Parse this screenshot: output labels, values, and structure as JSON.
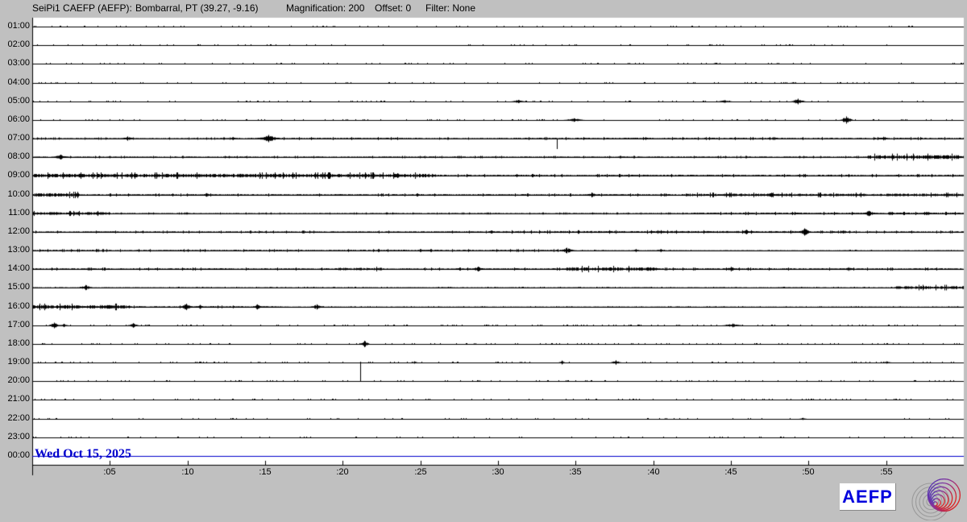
{
  "header": {
    "station": "SeiPi1 CAEFP (AEFP):",
    "location": "Bombarral, PT (39.27, -9.16)",
    "magnification": "Magnification: 200",
    "offset": "Offset: 0",
    "filter": "Filter: None"
  },
  "footer": {
    "date": "Wed Oct 15, 2025",
    "logo_text": "AEFP"
  },
  "colors": {
    "background": "#c0c0c0",
    "plot_bg": "#ffffff",
    "trace": "#000000",
    "accent_blue": "#0000cc"
  },
  "chart_data": {
    "type": "helicorder",
    "title": "24-hour seismogram, one row per hour, 60 minutes per row",
    "x_axis": {
      "minutes_per_row": 60,
      "tick_interval_min": 5,
      "tick_labels": [
        ":05",
        ":10",
        ":15",
        ":20",
        ":25",
        ":30",
        ":35",
        ":40",
        ":45",
        ":50",
        ":55"
      ]
    },
    "rows": [
      {
        "label": "01:00",
        "base": 0.3,
        "segments": [],
        "events": []
      },
      {
        "label": "02:00",
        "base": 0.3,
        "segments": [],
        "events": []
      },
      {
        "label": "03:00",
        "base": 0.3,
        "segments": [],
        "events": [
          {
            "m": 44,
            "a": 1,
            "w": 0.4
          }
        ]
      },
      {
        "label": "04:00",
        "base": 0.3,
        "segments": [],
        "events": [
          {
            "m": 49,
            "a": 1,
            "w": 0.4
          }
        ]
      },
      {
        "label": "05:00",
        "base": 0.35,
        "segments": [],
        "events": [
          {
            "m": 31.3,
            "a": 2,
            "w": 1
          },
          {
            "m": 44.6,
            "a": 1.5,
            "w": 1
          },
          {
            "m": 49.3,
            "a": 3.5,
            "w": 1
          }
        ]
      },
      {
        "label": "06:00",
        "base": 0.35,
        "segments": [],
        "events": [
          {
            "m": 34.9,
            "a": 2.2,
            "w": 1.4
          },
          {
            "m": 52.4,
            "a": 4.5,
            "w": 0.9
          }
        ]
      },
      {
        "label": "07:00",
        "base": 0.8,
        "segments": [
          [
            14,
            25,
            1
          ],
          [
            30,
            60,
            1
          ]
        ],
        "events": [
          {
            "m": 6.1,
            "a": 2.5,
            "w": 0.9
          },
          {
            "m": 12.9,
            "a": 1.8,
            "w": 0.6
          },
          {
            "m": 15.2,
            "a": 4.5,
            "w": 1.6
          },
          {
            "m": 33.8,
            "a": 13,
            "dir": "down"
          },
          {
            "m": 54.8,
            "a": 2.2,
            "w": 0.9
          }
        ]
      },
      {
        "label": "08:00",
        "base": 0.8,
        "segments": [
          [
            53.8,
            60,
            2.4
          ]
        ],
        "events": [
          {
            "m": 1.8,
            "a": 3,
            "w": 1.1
          }
        ]
      },
      {
        "label": "09:00",
        "base": 1.1,
        "segments": [
          [
            0,
            26,
            2.2
          ]
        ],
        "events": [
          {
            "m": 23.5,
            "a": 3,
            "w": 0.6
          }
        ]
      },
      {
        "label": "10:00",
        "base": 1.0,
        "segments": [
          [
            0,
            3,
            2.2
          ],
          [
            42,
            60,
            1.6
          ]
        ],
        "events": [
          {
            "m": 11.2,
            "a": 2.2,
            "w": 0.6
          },
          {
            "m": 36,
            "a": 3,
            "w": 0.9
          },
          {
            "m": 47.6,
            "a": 2.5,
            "w": 1.5
          }
        ]
      },
      {
        "label": "11:00",
        "base": 0.7,
        "segments": [
          [
            0,
            5,
            1.7
          ],
          [
            42,
            60,
            1.1
          ]
        ],
        "events": [
          {
            "m": 53.9,
            "a": 3.2,
            "w": 1.1
          },
          {
            "m": 57.6,
            "a": 2,
            "w": 0.9
          }
        ]
      },
      {
        "label": "12:00",
        "base": 0.9,
        "segments": [
          [
            30,
            50,
            1.2
          ]
        ],
        "events": [
          {
            "m": 29.6,
            "a": 2,
            "w": 0.6
          },
          {
            "m": 40.5,
            "a": 2.2,
            "w": 0.7
          },
          {
            "m": 46,
            "a": 2.8,
            "w": 0.7
          },
          {
            "m": 49.7,
            "a": 4.5,
            "w": 0.9
          },
          {
            "m": 52.2,
            "a": 2,
            "w": 0.5
          }
        ]
      },
      {
        "label": "13:00",
        "base": 0.5,
        "segments": [
          [
            0,
            34,
            0.95
          ]
        ],
        "events": [
          {
            "m": 34.4,
            "a": 3.5,
            "w": 1.1
          },
          {
            "m": 38.9,
            "a": 1.8,
            "w": 0.5
          },
          {
            "m": 40.5,
            "a": 1.8,
            "w": 0.5
          }
        ]
      },
      {
        "label": "14:00",
        "base": 1.0,
        "segments": [
          [
            19.5,
            22.5,
            1.6
          ],
          [
            34.4,
            40.2,
            2.2
          ]
        ],
        "events": [
          {
            "m": 28.7,
            "a": 3,
            "w": 0.9
          },
          {
            "m": 45,
            "a": 2.8,
            "w": 0.9
          },
          {
            "m": 52.6,
            "a": 2.2,
            "w": 0.7
          }
        ]
      },
      {
        "label": "15:00",
        "base": 0.55,
        "segments": [
          [
            55.5,
            60,
            1.9
          ]
        ],
        "events": [
          {
            "m": 3.4,
            "a": 3.2,
            "w": 0.9
          }
        ]
      },
      {
        "label": "16:00",
        "base": 0.5,
        "segments": [
          [
            0,
            6.3,
            2.3
          ],
          [
            6.3,
            16,
            0.95
          ]
        ],
        "events": [
          {
            "m": 9.9,
            "a": 4,
            "w": 0.9
          },
          {
            "m": 10.8,
            "a": 2.5,
            "w": 0.5
          },
          {
            "m": 14.5,
            "a": 3.2,
            "w": 0.6
          },
          {
            "m": 18.3,
            "a": 3.2,
            "w": 0.9
          }
        ]
      },
      {
        "label": "17:00",
        "base": 0.4,
        "segments": [],
        "events": [
          {
            "m": 1.4,
            "a": 3.5,
            "w": 0.8
          },
          {
            "m": 2,
            "a": 2,
            "w": 0.6
          },
          {
            "m": 6.5,
            "a": 2.8,
            "w": 0.8
          },
          {
            "m": 45.1,
            "a": 2.2,
            "w": 1.4
          }
        ]
      },
      {
        "label": "18:00",
        "base": 0.35,
        "segments": [],
        "events": [
          {
            "m": 21.4,
            "a": 4,
            "w": 0.7
          }
        ]
      },
      {
        "label": "19:00",
        "base": 0.35,
        "segments": [],
        "events": [
          {
            "m": 24.6,
            "a": 1.3,
            "w": 0.4
          },
          {
            "m": 34.1,
            "a": 2.2,
            "w": 0.4
          },
          {
            "m": 37.6,
            "a": 2.6,
            "w": 0.7
          },
          {
            "m": 55,
            "a": 1.4,
            "w": 0.6
          }
        ]
      },
      {
        "label": "20:00",
        "base": 0.35,
        "segments": [],
        "events": [
          {
            "m": 21.1,
            "a": 24,
            "dir": "up"
          }
        ]
      },
      {
        "label": "21:00",
        "base": 0.3,
        "segments": [],
        "events": []
      },
      {
        "label": "22:00",
        "base": 0.3,
        "segments": [],
        "events": [
          {
            "m": 49.6,
            "a": 1.3,
            "w": 0.5
          }
        ]
      },
      {
        "label": "23:00",
        "base": 0.3,
        "segments": [],
        "events": []
      },
      {
        "label": "00:00",
        "base": 0,
        "segments": [],
        "events": [],
        "color": "#0000cc"
      }
    ]
  }
}
